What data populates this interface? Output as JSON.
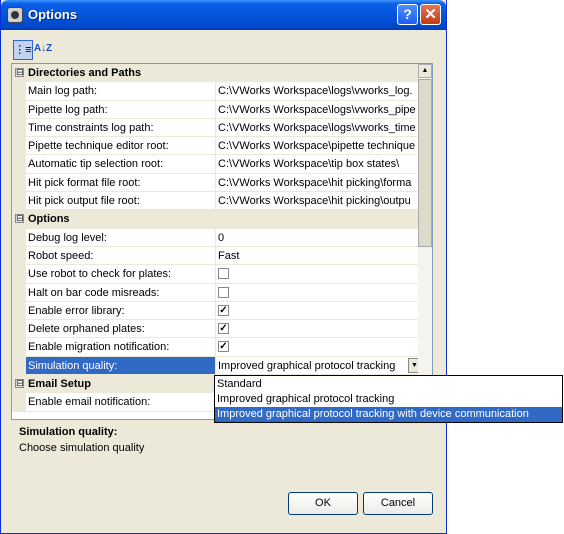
{
  "window": {
    "title": "Options",
    "help_label": "?",
    "close_label": "✕"
  },
  "toolbar": {
    "categorized_label": "⋮≡",
    "alphabetical_label": "A↓Z"
  },
  "grid": {
    "categories": [
      {
        "label": "Directories and Paths",
        "toggle": "⊟"
      },
      {
        "label": "Options",
        "toggle": "⊟"
      },
      {
        "label": "Email Setup",
        "toggle": "⊟"
      }
    ],
    "paths": [
      {
        "name": "Main log path:",
        "value": "C:\\VWorks Workspace\\logs\\vworks_log."
      },
      {
        "name": "Pipette log path:",
        "value": "C:\\VWorks Workspace\\logs\\vworks_pipe"
      },
      {
        "name": "Time constraints log path:",
        "value": "C:\\VWorks Workspace\\logs\\vworks_time"
      },
      {
        "name": "Pipette technique editor root:",
        "value": "C:\\VWorks Workspace\\pipette technique"
      },
      {
        "name": "Automatic tip selection root:",
        "value": "C:\\VWorks Workspace\\tip box states\\"
      },
      {
        "name": "Hit pick format file root:",
        "value": "C:\\VWorks Workspace\\hit picking\\forma"
      },
      {
        "name": "Hit pick output file root:",
        "value": "C:\\VWorks Workspace\\hit picking\\outpu"
      }
    ],
    "options": [
      {
        "name": "Debug log level:",
        "value": "0"
      },
      {
        "name": "Robot speed:",
        "value": "Fast"
      },
      {
        "name": "Use robot to check for plates:",
        "check": ""
      },
      {
        "name": "Halt on bar code misreads:",
        "check": ""
      },
      {
        "name": "Enable error library:",
        "check": "✓"
      },
      {
        "name": "Delete orphaned plates:",
        "check": "✓"
      },
      {
        "name": "Enable migration notification:",
        "check": "✓"
      },
      {
        "name": "Simulation quality:",
        "value": "Improved graphical protocol tracking"
      }
    ],
    "email": [
      {
        "name": "Enable email notification:",
        "value": ""
      }
    ],
    "dropdown_arrow": "▼",
    "scroll_up": "▲"
  },
  "dropdown": {
    "options": [
      "Standard",
      "Improved graphical protocol tracking",
      "Improved graphical protocol tracking with device communication"
    ]
  },
  "description": {
    "title": "Simulation quality:",
    "text": "Choose simulation quality"
  },
  "buttons": {
    "ok": "OK",
    "cancel": "Cancel"
  }
}
